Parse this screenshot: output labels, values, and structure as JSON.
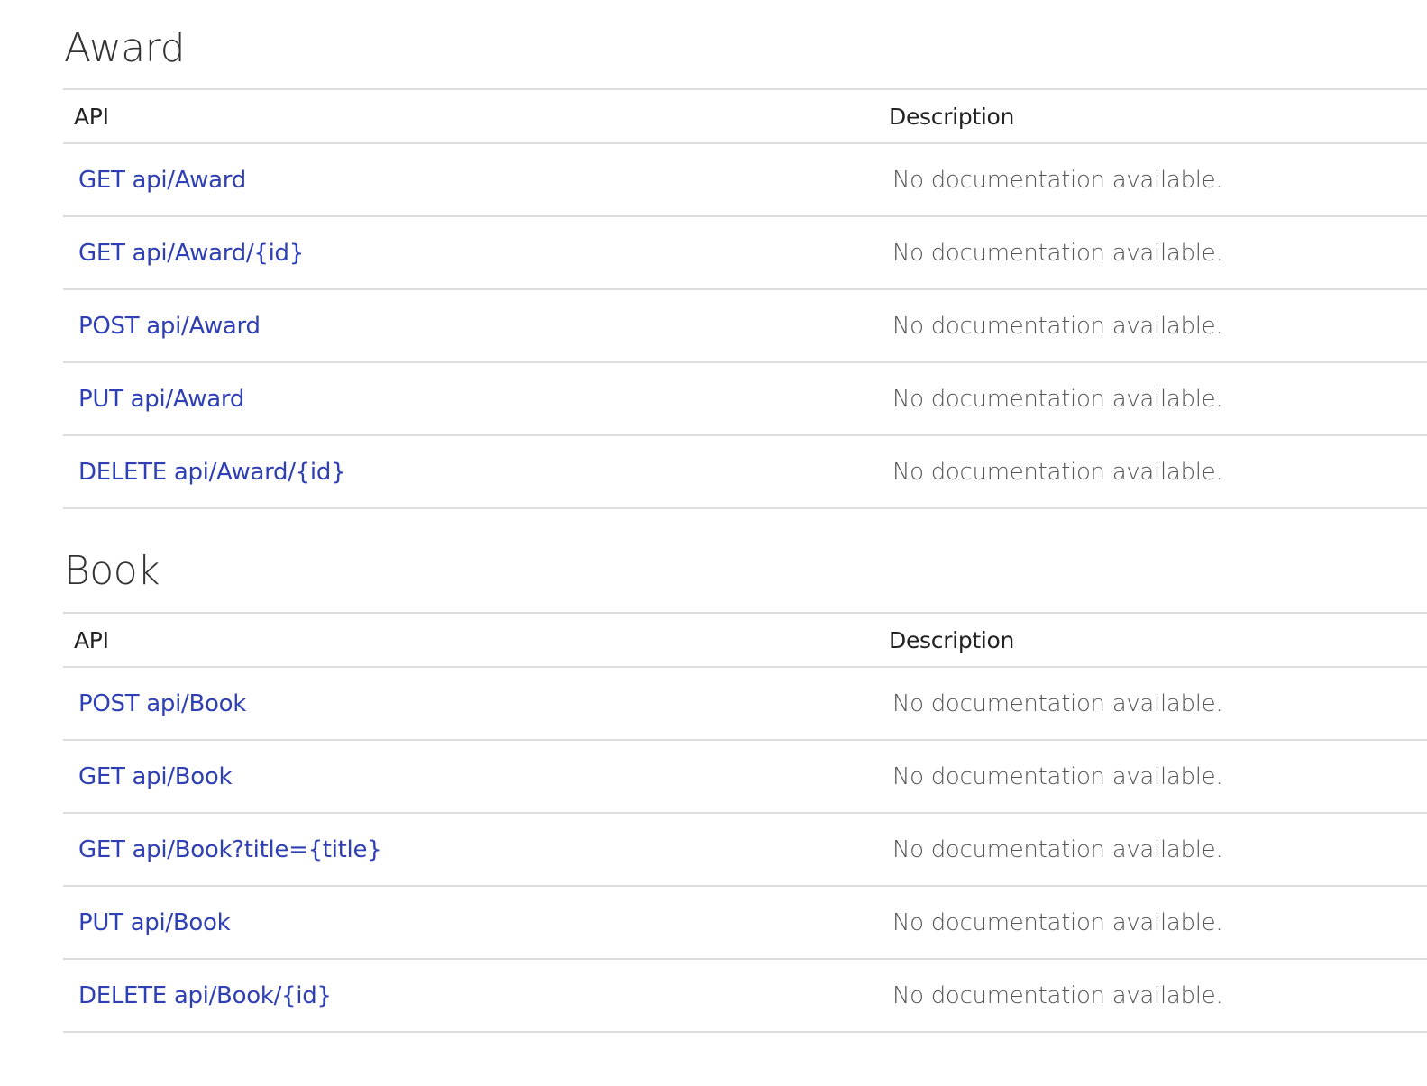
{
  "sections": [
    {
      "title": "Award",
      "headers": {
        "api": "API",
        "description": "Description"
      },
      "rows": [
        {
          "api": "GET api/Award",
          "description": "No documentation available."
        },
        {
          "api": "GET api/Award/{id}",
          "description": "No documentation available."
        },
        {
          "api": "POST api/Award",
          "description": "No documentation available."
        },
        {
          "api": "PUT api/Award",
          "description": "No documentation available."
        },
        {
          "api": "DELETE api/Award/{id}",
          "description": "No documentation available."
        }
      ]
    },
    {
      "title": "Book",
      "headers": {
        "api": "API",
        "description": "Description"
      },
      "rows": [
        {
          "api": "POST api/Book",
          "description": "No documentation available."
        },
        {
          "api": "GET api/Book",
          "description": "No documentation available."
        },
        {
          "api": "GET api/Book?title={title}",
          "description": "No documentation available."
        },
        {
          "api": "PUT api/Book",
          "description": "No documentation available."
        },
        {
          "api": "DELETE api/Book/{id}",
          "description": "No documentation available."
        }
      ]
    }
  ],
  "colors": {
    "link": "#2f3fb4",
    "heading": "#333333",
    "description": "#555555",
    "border": "#dddddd"
  }
}
